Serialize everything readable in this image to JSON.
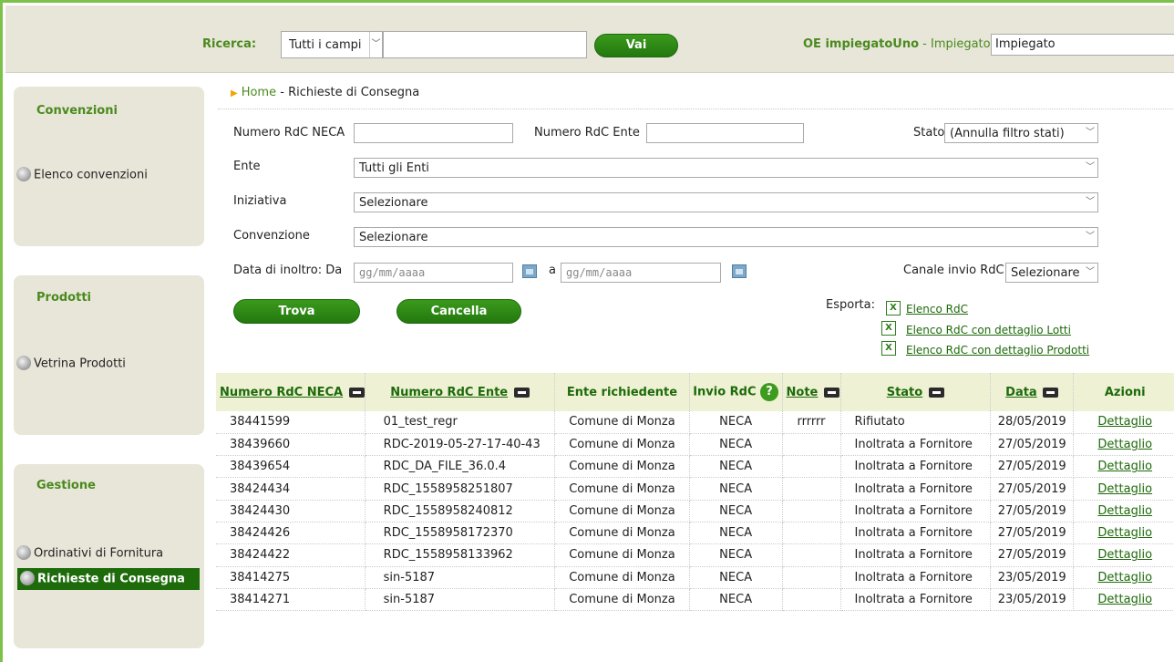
{
  "header": {
    "search_label": "Ricerca:",
    "search_scope": "Tutti i campi",
    "search_value": "",
    "go_label": "Vai",
    "user_name": "OE impiegatoUno",
    "user_sep": " - ",
    "user_role": "Impiegato",
    "role_select": "Impiegato"
  },
  "sidebar": {
    "sections": [
      {
        "title": "Convenzioni",
        "items": [
          "Elenco convenzioni"
        ]
      },
      {
        "title": "Prodotti",
        "items": [
          "Vetrina Prodotti"
        ]
      },
      {
        "title": "Gestione",
        "items": [
          "Ordinativi di Fornitura",
          "Richieste di Consegna"
        ]
      }
    ],
    "active_item": "Richieste di Consegna"
  },
  "breadcrumb": {
    "home": "Home",
    "sep": " - ",
    "current": "Richieste di Consegna"
  },
  "filters": {
    "numero_neca_label": "Numero RdC NECA",
    "numero_neca_value": "",
    "numero_ente_label": "Numero RdC Ente",
    "numero_ente_value": "",
    "stato_label": "Stato",
    "stato_value": "(Annulla filtro stati)",
    "ente_label": "Ente",
    "ente_value": "Tutti gli Enti",
    "iniziativa_label": "Iniziativa",
    "iniziativa_value": "Selezionare",
    "convenzione_label": "Convenzione",
    "convenzione_value": "Selezionare",
    "data_label": "Data di inoltro: Da",
    "data_da_placeholder": "gg/mm/aaaa",
    "data_a_label": "a",
    "data_a_placeholder": "gg/mm/aaaa",
    "canale_label": "Canale invio RdC",
    "canale_value": "Selezionare"
  },
  "actions": {
    "trova": "Trova",
    "cancella": "Cancella"
  },
  "export": {
    "label": "Esporta:",
    "links": [
      "Elenco RdC",
      "Elenco RdC con dettaglio Lotti",
      "Elenco RdC con dettaglio Prodotti"
    ]
  },
  "table": {
    "columns": [
      "Numero RdC NECA",
      "Numero RdC Ente",
      "Ente richiedente",
      "Invio RdC",
      "Note",
      "Stato",
      "Data",
      "Azioni"
    ],
    "help_glyph": "?",
    "rows": [
      [
        "38441599",
        "01_test_regr",
        "Comune di Monza",
        "NECA",
        "rrrrrr",
        "Rifiutato",
        "28/05/2019",
        "Dettaglio"
      ],
      [
        "38439660",
        "RDC-2019-05-27-17-40-43",
        "Comune di Monza",
        "NECA",
        "",
        "Inoltrata a Fornitore",
        "27/05/2019",
        "Dettaglio"
      ],
      [
        "38439654",
        "RDC_DA_FILE_36.0.4",
        "Comune di Monza",
        "NECA",
        "",
        "Inoltrata a Fornitore",
        "27/05/2019",
        "Dettaglio"
      ],
      [
        "38424434",
        "RDC_1558958251807",
        "Comune di Monza",
        "NECA",
        "",
        "Inoltrata a Fornitore",
        "27/05/2019",
        "Dettaglio"
      ],
      [
        "38424430",
        "RDC_1558958240812",
        "Comune di Monza",
        "NECA",
        "",
        "Inoltrata a Fornitore",
        "27/05/2019",
        "Dettaglio"
      ],
      [
        "38424426",
        "RDC_1558958172370",
        "Comune di Monza",
        "NECA",
        "",
        "Inoltrata a Fornitore",
        "27/05/2019",
        "Dettaglio"
      ],
      [
        "38424422",
        "RDC_1558958133962",
        "Comune di Monza",
        "NECA",
        "",
        "Inoltrata a Fornitore",
        "27/05/2019",
        "Dettaglio"
      ],
      [
        "38414275",
        "sin-5187",
        "Comune di Monza",
        "NECA",
        "",
        "Inoltrata a Fornitore",
        "23/05/2019",
        "Dettaglio"
      ],
      [
        "38414271",
        "sin-5187",
        "Comune di Monza",
        "NECA",
        "",
        "Inoltrata a Fornitore",
        "23/05/2019",
        "Dettaglio"
      ]
    ]
  },
  "colors": {
    "brand_green": "#4a8a1e",
    "button_green": "#23780f",
    "active_nav": "#1e6b0c",
    "panel_bg": "#e8e6d9",
    "header_row": "#eef1d4"
  }
}
